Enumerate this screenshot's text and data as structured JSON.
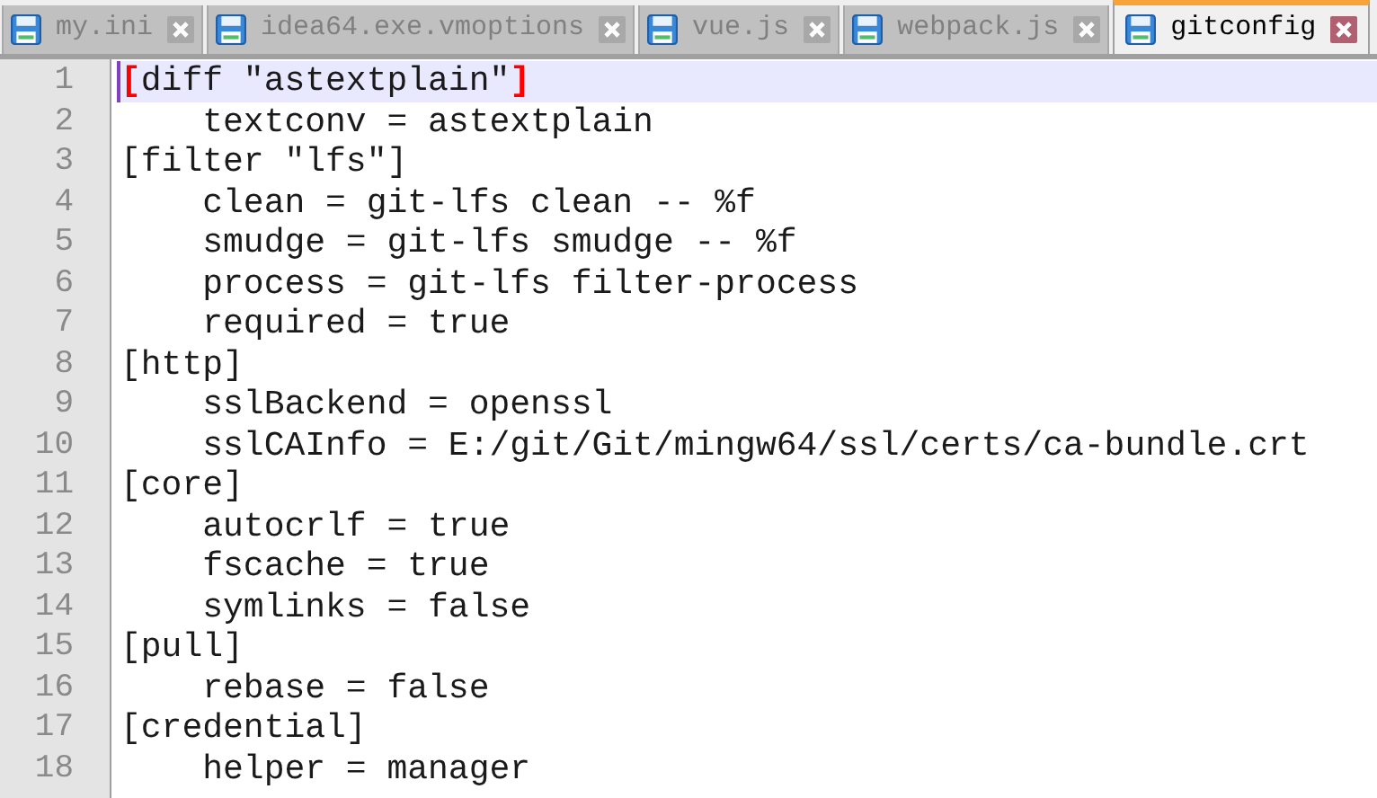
{
  "tabs": [
    {
      "label": "my.ini",
      "selected": false
    },
    {
      "label": "idea64.exe.vmoptions",
      "selected": false
    },
    {
      "label": "vue.js",
      "selected": false
    },
    {
      "label": "webpack.js",
      "selected": false
    },
    {
      "label": "gitconfig",
      "selected": true
    }
  ],
  "editor": {
    "lines": [
      {
        "number": "1",
        "current": true,
        "segments": [
          {
            "text": "[",
            "kind": "brace"
          },
          {
            "text": "diff \"astextplain\"",
            "kind": "plain"
          },
          {
            "text": "]",
            "kind": "brace"
          }
        ]
      },
      {
        "number": "2",
        "current": false,
        "segments": [
          {
            "text": "    textconv = astextplain",
            "kind": "plain"
          }
        ]
      },
      {
        "number": "3",
        "current": false,
        "segments": [
          {
            "text": "[filter \"lfs\"]",
            "kind": "plain"
          }
        ]
      },
      {
        "number": "4",
        "current": false,
        "segments": [
          {
            "text": "    clean = git-lfs clean -- %f",
            "kind": "plain"
          }
        ]
      },
      {
        "number": "5",
        "current": false,
        "segments": [
          {
            "text": "    smudge = git-lfs smudge -- %f",
            "kind": "plain"
          }
        ]
      },
      {
        "number": "6",
        "current": false,
        "segments": [
          {
            "text": "    process = git-lfs filter-process",
            "kind": "plain"
          }
        ]
      },
      {
        "number": "7",
        "current": false,
        "segments": [
          {
            "text": "    required = true",
            "kind": "plain"
          }
        ]
      },
      {
        "number": "8",
        "current": false,
        "segments": [
          {
            "text": "[http]",
            "kind": "plain"
          }
        ]
      },
      {
        "number": "9",
        "current": false,
        "segments": [
          {
            "text": "    sslBackend = openssl",
            "kind": "plain"
          }
        ]
      },
      {
        "number": "10",
        "current": false,
        "segments": [
          {
            "text": "    sslCAInfo = E:/git/Git/mingw64/ssl/certs/ca-bundle.crt",
            "kind": "plain"
          }
        ]
      },
      {
        "number": "11",
        "current": false,
        "segments": [
          {
            "text": "[core]",
            "kind": "plain"
          }
        ]
      },
      {
        "number": "12",
        "current": false,
        "segments": [
          {
            "text": "    autocrlf = true",
            "kind": "plain"
          }
        ]
      },
      {
        "number": "13",
        "current": false,
        "segments": [
          {
            "text": "    fscache = true",
            "kind": "plain"
          }
        ]
      },
      {
        "number": "14",
        "current": false,
        "segments": [
          {
            "text": "    symlinks = false",
            "kind": "plain"
          }
        ]
      },
      {
        "number": "15",
        "current": false,
        "segments": [
          {
            "text": "[pull]",
            "kind": "plain"
          }
        ]
      },
      {
        "number": "16",
        "current": false,
        "segments": [
          {
            "text": "    rebase = false",
            "kind": "plain"
          }
        ]
      },
      {
        "number": "17",
        "current": false,
        "segments": [
          {
            "text": "[credential]",
            "kind": "plain"
          }
        ]
      },
      {
        "number": "18",
        "current": false,
        "segments": [
          {
            "text": "    helper = manager",
            "kind": "plain"
          }
        ]
      }
    ]
  }
}
